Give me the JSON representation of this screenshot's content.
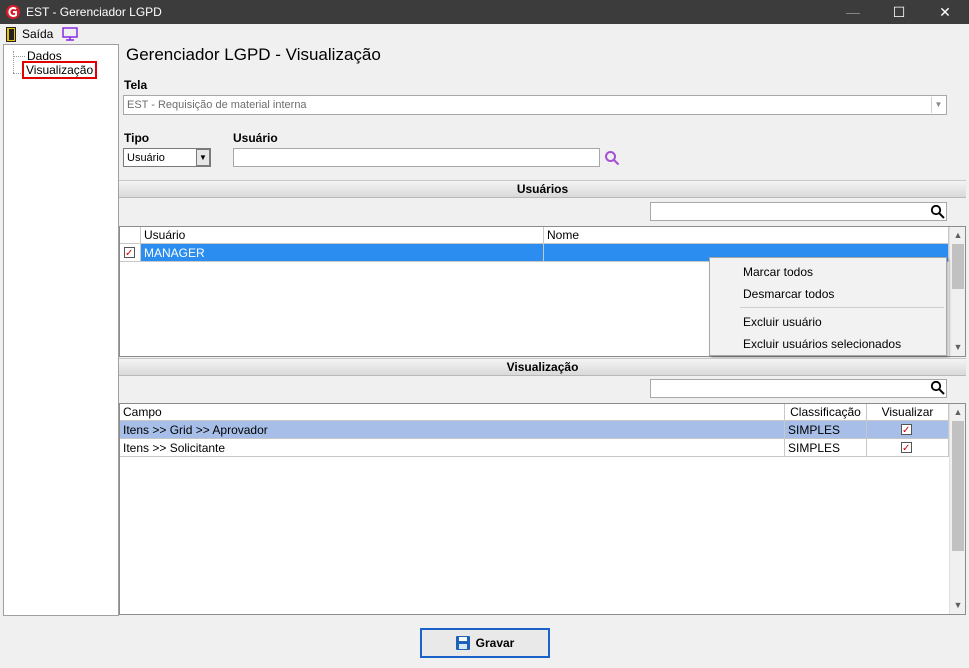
{
  "window": {
    "title": "EST - Gerenciador LGPD",
    "minimize": "—",
    "maximize": "☐",
    "close": "✕"
  },
  "toolbar": {
    "exit_label": "Saída"
  },
  "tree": {
    "items": [
      "Dados",
      "Visualização"
    ],
    "selected": "Visualização"
  },
  "main": {
    "title": "Gerenciador LGPD - Visualização",
    "tela_label": "Tela",
    "tela_value": "EST - Requisição de material interna",
    "tipo_label": "Tipo",
    "tipo_value": "Usuário",
    "usuario_label": "Usuário",
    "usuario_value": ""
  },
  "usuarios_section": {
    "title": "Usuários",
    "filter_value": "",
    "columns": [
      "Usuário",
      "Nome"
    ],
    "rows": [
      {
        "checked": true,
        "usuario": "MANAGER",
        "nome": ""
      }
    ]
  },
  "context_menu": {
    "items": [
      "Marcar todos",
      "Desmarcar todos",
      "Excluir usuário",
      "Excluir usuários selecionados"
    ]
  },
  "visualizacao_section": {
    "title": "Visualização",
    "filter_value": "",
    "columns": [
      "Campo",
      "Classificação",
      "Visualizar"
    ],
    "rows": [
      {
        "campo": "Itens >> Grid >> Aprovador",
        "classificacao": "SIMPLES",
        "visualizar": true
      },
      {
        "campo": "Itens >> Solicitante",
        "classificacao": "SIMPLES",
        "visualizar": true
      }
    ]
  },
  "buttons": {
    "save_label": "Gravar"
  },
  "colors": {
    "selection_blue": "#2c8df0",
    "row_highlight": "#a7bfe8",
    "title_bar": "#3c3c3c",
    "accent_red": "#e00000"
  }
}
